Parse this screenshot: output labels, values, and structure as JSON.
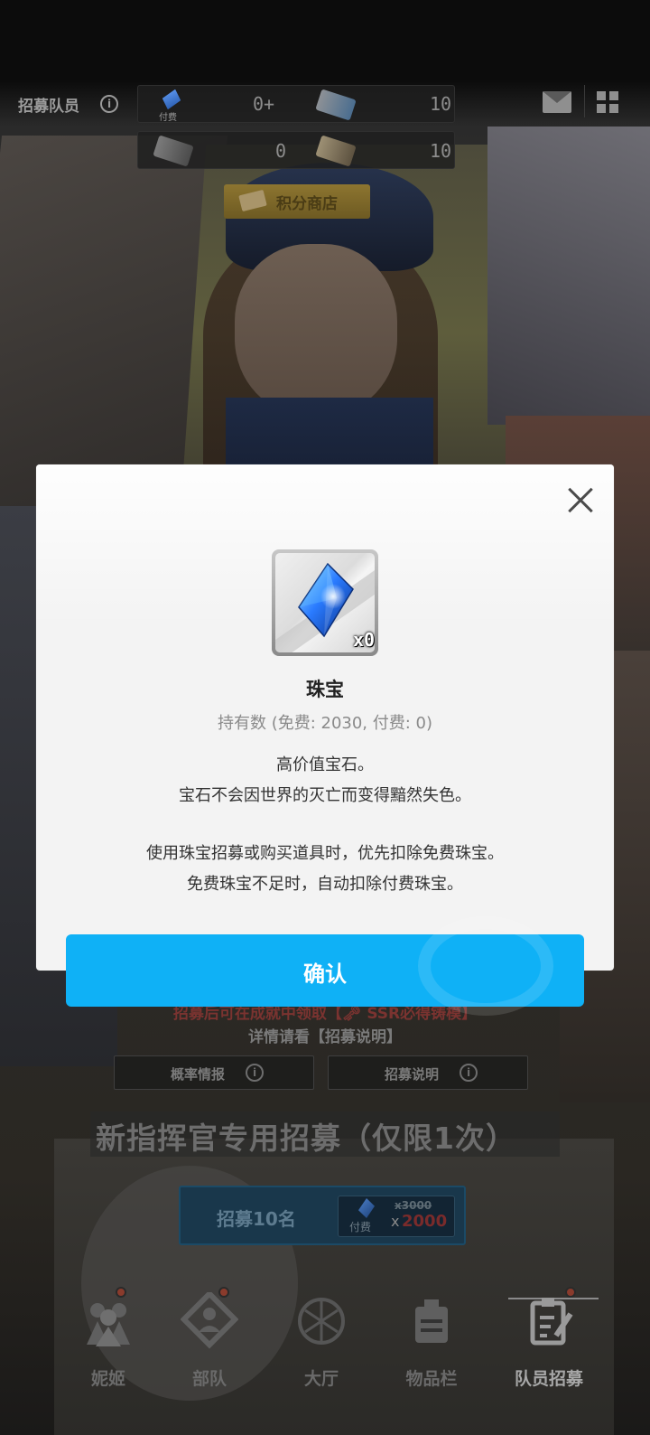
{
  "top_bar": {
    "title": "招募队员",
    "gem_tag": "付费",
    "paid_gems_value": "0+",
    "ticket_blue_value": "10",
    "ticket_grey_value": "0",
    "ticket_gold_value": "10"
  },
  "points_shop": {
    "label": "积分商店"
  },
  "background": {
    "note_red": "招募后可在成就中领取【🗝 SSR必得铸模】",
    "note_grey": "详情请看【招募说明】",
    "rate_info_label": "概率情报",
    "recruit_info_label": "招募说明",
    "banner_title": "新指挥官专用招募（仅限1次）",
    "recruit_button": {
      "label": "招募10名",
      "paid_tag": "付费",
      "old_cost": "x3000",
      "x_prefix": "x",
      "new_cost": "2000"
    }
  },
  "nav": {
    "items": [
      {
        "label": "妮姬",
        "icon": "nikke-icon"
      },
      {
        "label": "部队",
        "icon": "squad-icon"
      },
      {
        "label": "大厅",
        "icon": "lobby-icon"
      },
      {
        "label": "物品栏",
        "icon": "inventory-icon"
      },
      {
        "label": "队员招募",
        "icon": "recruit-icon"
      }
    ],
    "active_index": 4
  },
  "modal": {
    "item_quantity": "x0",
    "item_name": "珠宝",
    "item_held": "持有数 (免费: 2030, 付费: 0)",
    "description_lines": [
      "高价值宝石。",
      "宝石不会因世界的灭亡而变得黯然失色。",
      "使用珠宝招募或购买道具时，优先扣除免费珠宝。",
      "免费珠宝不足时，自动扣除付费珠宝。"
    ],
    "confirm_label": "确认"
  },
  "colors": {
    "confirm_blue": "#0fb1f6",
    "modal_bg": "#f3f3f3",
    "crystal_blue": "#2a7bff"
  }
}
